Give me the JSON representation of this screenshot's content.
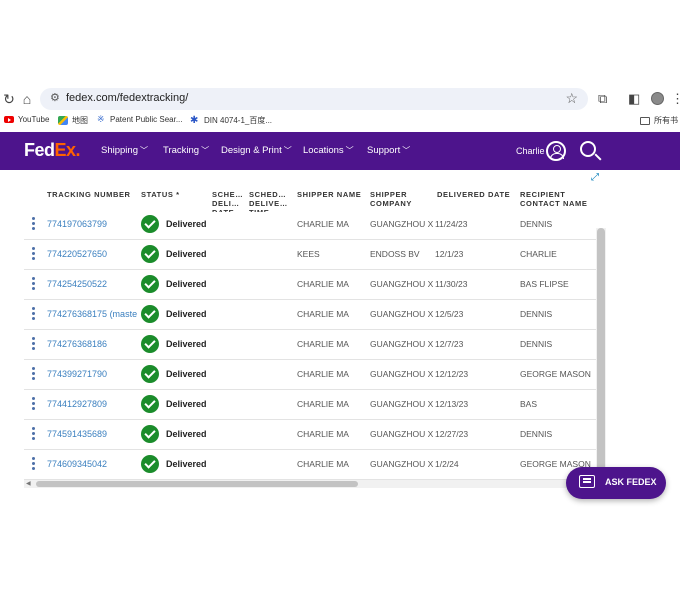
{
  "browser": {
    "url": "fedex.com/fedextracking/",
    "bookmarks": [
      {
        "label": "YouTube",
        "icon": "youtube-icon"
      },
      {
        "label": "地图",
        "icon": "maps-icon"
      },
      {
        "label": "Patent Public Sear...",
        "icon": "patent-icon"
      },
      {
        "label": "DIN 4074-1_百度...",
        "icon": "baidu-paw-icon"
      },
      {
        "label": "所有书",
        "icon": "folder-icon"
      }
    ]
  },
  "header": {
    "logo_fed": "Fed",
    "logo_ex": "Ex",
    "logo_dot": ".",
    "nav": [
      "Shipping",
      "Tracking",
      "Design & Print",
      "Locations",
      "Support"
    ],
    "user_name": "Charlie",
    "brand_color": "#4d148c",
    "accent_color": "#ff6200"
  },
  "table": {
    "columns": [
      "TRACKING NUMBER",
      "STATUS *",
      "SCHE… DELI… DATE",
      "SCHED… DELIVE… TIME",
      "SHIPPER NAME",
      "SHIPPER COMPANY",
      "DELIVERED DATE",
      "RECIPIENT CONTACT NAME"
    ],
    "rows": [
      {
        "tracking": "774197063799",
        "status": "Delivered",
        "shipper_name": "CHARLIE MA",
        "shipper_company": "GUANGZHOU X",
        "delivered_date": "11/24/23",
        "recipient": "DENNIS"
      },
      {
        "tracking": "774220527650",
        "status": "Delivered",
        "shipper_name": "KEES",
        "shipper_company": "ENDOSS BV",
        "delivered_date": "12/1/23",
        "recipient": "CHARLIE"
      },
      {
        "tracking": "774254250522",
        "status": "Delivered",
        "shipper_name": "CHARLIE MA",
        "shipper_company": "GUANGZHOU X",
        "delivered_date": "11/30/23",
        "recipient": "BAS FLIPSE"
      },
      {
        "tracking": "774276368175 (maste",
        "status": "Delivered",
        "shipper_name": "CHARLIE MA",
        "shipper_company": "GUANGZHOU X",
        "delivered_date": "12/5/23",
        "recipient": "DENNIS"
      },
      {
        "tracking": "774276368186",
        "status": "Delivered",
        "shipper_name": "CHARLIE MA",
        "shipper_company": "GUANGZHOU X",
        "delivered_date": "12/7/23",
        "recipient": "DENNIS"
      },
      {
        "tracking": "774399271790",
        "status": "Delivered",
        "shipper_name": "CHARLIE MA",
        "shipper_company": "GUANGZHOU X",
        "delivered_date": "12/12/23",
        "recipient": "GEORGE MASON"
      },
      {
        "tracking": "774412927809",
        "status": "Delivered",
        "shipper_name": "CHARLIE MA",
        "shipper_company": "GUANGZHOU X",
        "delivered_date": "12/13/23",
        "recipient": "BAS"
      },
      {
        "tracking": "774591435689",
        "status": "Delivered",
        "shipper_name": "CHARLIE MA",
        "shipper_company": "GUANGZHOU X",
        "delivered_date": "12/27/23",
        "recipient": "DENNIS"
      },
      {
        "tracking": "774609345042",
        "status": "Delivered",
        "shipper_name": "CHARLIE MA",
        "shipper_company": "GUANGZHOU X",
        "delivered_date": "1/2/24",
        "recipient": "GEORGE MASON"
      }
    ]
  },
  "ask_fedex": {
    "label": "ASK FEDEX"
  }
}
